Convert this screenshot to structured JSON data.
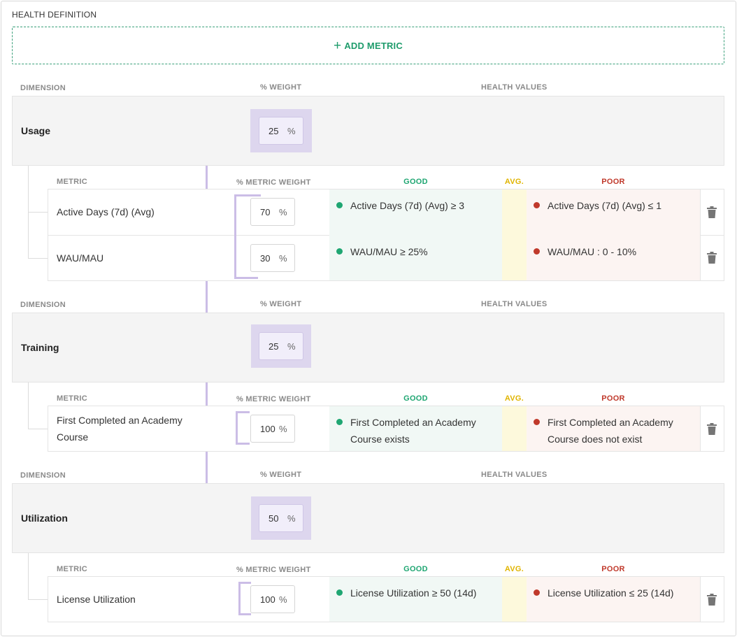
{
  "section": {
    "title": "HEALTH DEFINITION",
    "add_metric_label": "ADD METRIC"
  },
  "headers": {
    "dimension": "DIMENSION",
    "weight": "% WEIGHT",
    "health_values": "HEALTH VALUES",
    "metric": "METRIC",
    "metric_weight": "% METRIC WEIGHT",
    "good": "GOOD",
    "avg": "AVG.",
    "poor": "POOR"
  },
  "colors": {
    "good": "#1fa672",
    "avg": "#e0b400",
    "poor": "#c0392b",
    "accent": "#cbbde6"
  },
  "dimensions": [
    {
      "name": "Usage",
      "weight": "25",
      "weight_unit": "%",
      "metrics": [
        {
          "name": "Active Days (7d) (Avg)",
          "weight": "70",
          "unit": "%",
          "good": "Active Days (7d) (Avg) ≥ 3",
          "poor": "Active Days (7d) (Avg) ≤ 1",
          "delete_icon": "trash-icon"
        },
        {
          "name": "WAU/MAU",
          "weight": "30",
          "unit": "%",
          "good": "WAU/MAU ≥ 25%",
          "poor": "WAU/MAU : 0 - 10%",
          "delete_icon": "trash-icon"
        }
      ]
    },
    {
      "name": "Training",
      "weight": "25",
      "weight_unit": "%",
      "metrics": [
        {
          "name": "First Completed an Academy Course",
          "weight": "100",
          "unit": "%",
          "good": "First Completed an Academy Course exists",
          "poor": "First Completed an Academy Course does not exist",
          "delete_icon": "trash-icon"
        }
      ]
    },
    {
      "name": "Utilization",
      "weight": "50",
      "weight_unit": "%",
      "metrics": [
        {
          "name": "License Utilization",
          "weight": "100",
          "unit": "%",
          "good": "License Utilization ≥ 50 (14d)",
          "poor": "License Utilization ≤ 25 (14d)",
          "delete_icon": "trash-icon"
        }
      ]
    }
  ]
}
